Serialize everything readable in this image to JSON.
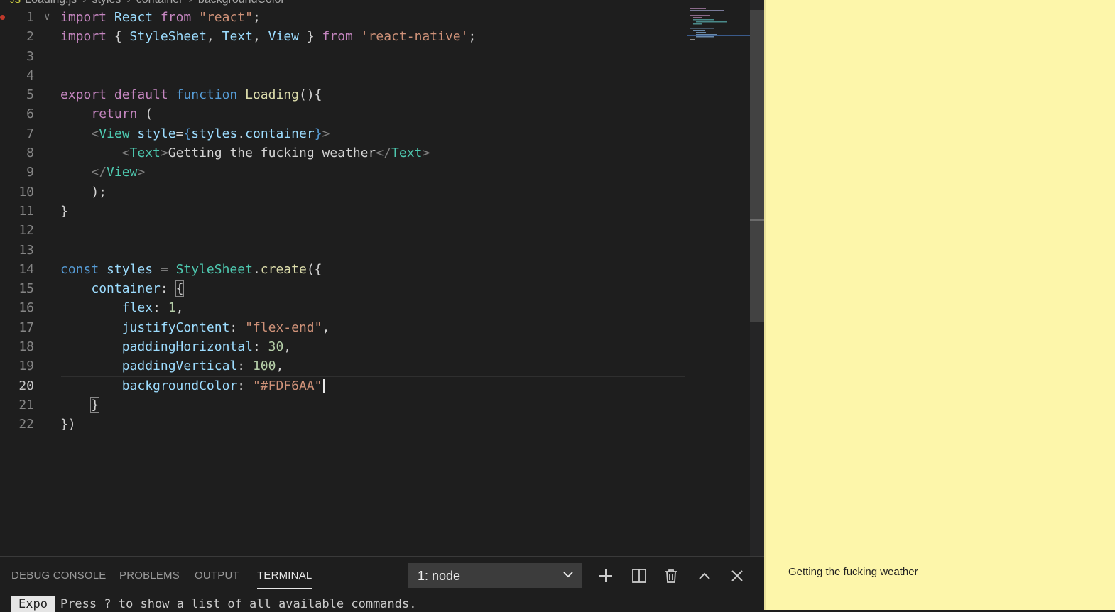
{
  "breadcrumb": {
    "file": "Loading.js",
    "items": [
      "styles",
      "container",
      "backgroundColor"
    ]
  },
  "editor": {
    "lines": [
      [
        [
          "k",
          "import"
        ],
        [
          "p",
          " "
        ],
        [
          "v",
          "React"
        ],
        [
          "p",
          " "
        ],
        [
          "k",
          "from"
        ],
        [
          "p",
          " "
        ],
        [
          "s",
          "\"react\""
        ],
        [
          "p",
          ";"
        ]
      ],
      [
        [
          "k",
          "import"
        ],
        [
          "p",
          " { "
        ],
        [
          "v",
          "StyleSheet"
        ],
        [
          "p",
          ", "
        ],
        [
          "v",
          "Text"
        ],
        [
          "p",
          ", "
        ],
        [
          "v",
          "View"
        ],
        [
          "p",
          " } "
        ],
        [
          "k",
          "from"
        ],
        [
          "p",
          " "
        ],
        [
          "s",
          "'react-native'"
        ],
        [
          "p",
          ";"
        ]
      ],
      [],
      [],
      [
        [
          "k",
          "export"
        ],
        [
          "p",
          " "
        ],
        [
          "k",
          "default"
        ],
        [
          "p",
          " "
        ],
        [
          "b",
          "function"
        ],
        [
          "p",
          " "
        ],
        [
          "f",
          "Loading"
        ],
        [
          "p",
          "(){"
        ]
      ],
      [
        [
          "p",
          "    "
        ],
        [
          "k",
          "return"
        ],
        [
          "p",
          " ("
        ]
      ],
      [
        [
          "p",
          "    "
        ],
        [
          "g",
          "<"
        ],
        [
          "t",
          "View"
        ],
        [
          "p",
          " "
        ],
        [
          "v",
          "style"
        ],
        [
          "p",
          "="
        ],
        [
          "b",
          "{"
        ],
        [
          "v",
          "styles"
        ],
        [
          "p",
          "."
        ],
        [
          "v",
          "container"
        ],
        [
          "b",
          "}"
        ],
        [
          "g",
          ">"
        ]
      ],
      [
        [
          "p",
          "        "
        ],
        [
          "g",
          "<"
        ],
        [
          "t",
          "Text"
        ],
        [
          "g",
          ">"
        ],
        [
          "p",
          "Getting the fucking weather"
        ],
        [
          "g",
          "</"
        ],
        [
          "t",
          "Text"
        ],
        [
          "g",
          ">"
        ]
      ],
      [
        [
          "p",
          "    "
        ],
        [
          "g",
          "</"
        ],
        [
          "t",
          "View"
        ],
        [
          "g",
          ">"
        ]
      ],
      [
        [
          "p",
          "    );"
        ]
      ],
      [
        [
          "p",
          "}"
        ]
      ],
      [],
      [],
      [
        [
          "b",
          "const"
        ],
        [
          "p",
          " "
        ],
        [
          "v",
          "styles"
        ],
        [
          "p",
          " = "
        ],
        [
          "t",
          "StyleSheet"
        ],
        [
          "p",
          "."
        ],
        [
          "f",
          "create"
        ],
        [
          "p",
          "({"
        ]
      ],
      [
        [
          "p",
          "    "
        ],
        [
          "v",
          "container"
        ],
        [
          "p",
          ": "
        ],
        [
          "box",
          "{"
        ]
      ],
      [
        [
          "p",
          "        "
        ],
        [
          "v",
          "flex"
        ],
        [
          "p",
          ": "
        ],
        [
          "n",
          "1"
        ],
        [
          "p",
          ","
        ]
      ],
      [
        [
          "p",
          "        "
        ],
        [
          "v",
          "justifyContent"
        ],
        [
          "p",
          ": "
        ],
        [
          "s",
          "\"flex-end\""
        ],
        [
          "p",
          ","
        ]
      ],
      [
        [
          "p",
          "        "
        ],
        [
          "v",
          "paddingHorizontal"
        ],
        [
          "p",
          ": "
        ],
        [
          "n",
          "30"
        ],
        [
          "p",
          ","
        ]
      ],
      [
        [
          "p",
          "        "
        ],
        [
          "v",
          "paddingVertical"
        ],
        [
          "p",
          ": "
        ],
        [
          "n",
          "100"
        ],
        [
          "p",
          ","
        ]
      ],
      [
        [
          "p",
          "        "
        ],
        [
          "v",
          "backgroundColor"
        ],
        [
          "p",
          ": "
        ],
        [
          "s",
          "\"#FDF6AA\""
        ],
        [
          "caret",
          ""
        ]
      ],
      [
        [
          "p",
          "    "
        ],
        [
          "box",
          "}"
        ]
      ],
      [
        [
          "p",
          "})"
        ]
      ]
    ],
    "active_line": 20,
    "breakpoint_line": 1,
    "fold_line": 1
  },
  "panel": {
    "tabs": [
      "DEBUG CONSOLE",
      "PROBLEMS",
      "OUTPUT",
      "TERMINAL"
    ],
    "active_tab": "TERMINAL",
    "terminal_select": "1: node",
    "terminal_badge": "Expo",
    "terminal_text": "Press ? to show a list of all available commands."
  },
  "preview": {
    "text": "Getting the fucking weather",
    "background": "#FDF6AA"
  }
}
